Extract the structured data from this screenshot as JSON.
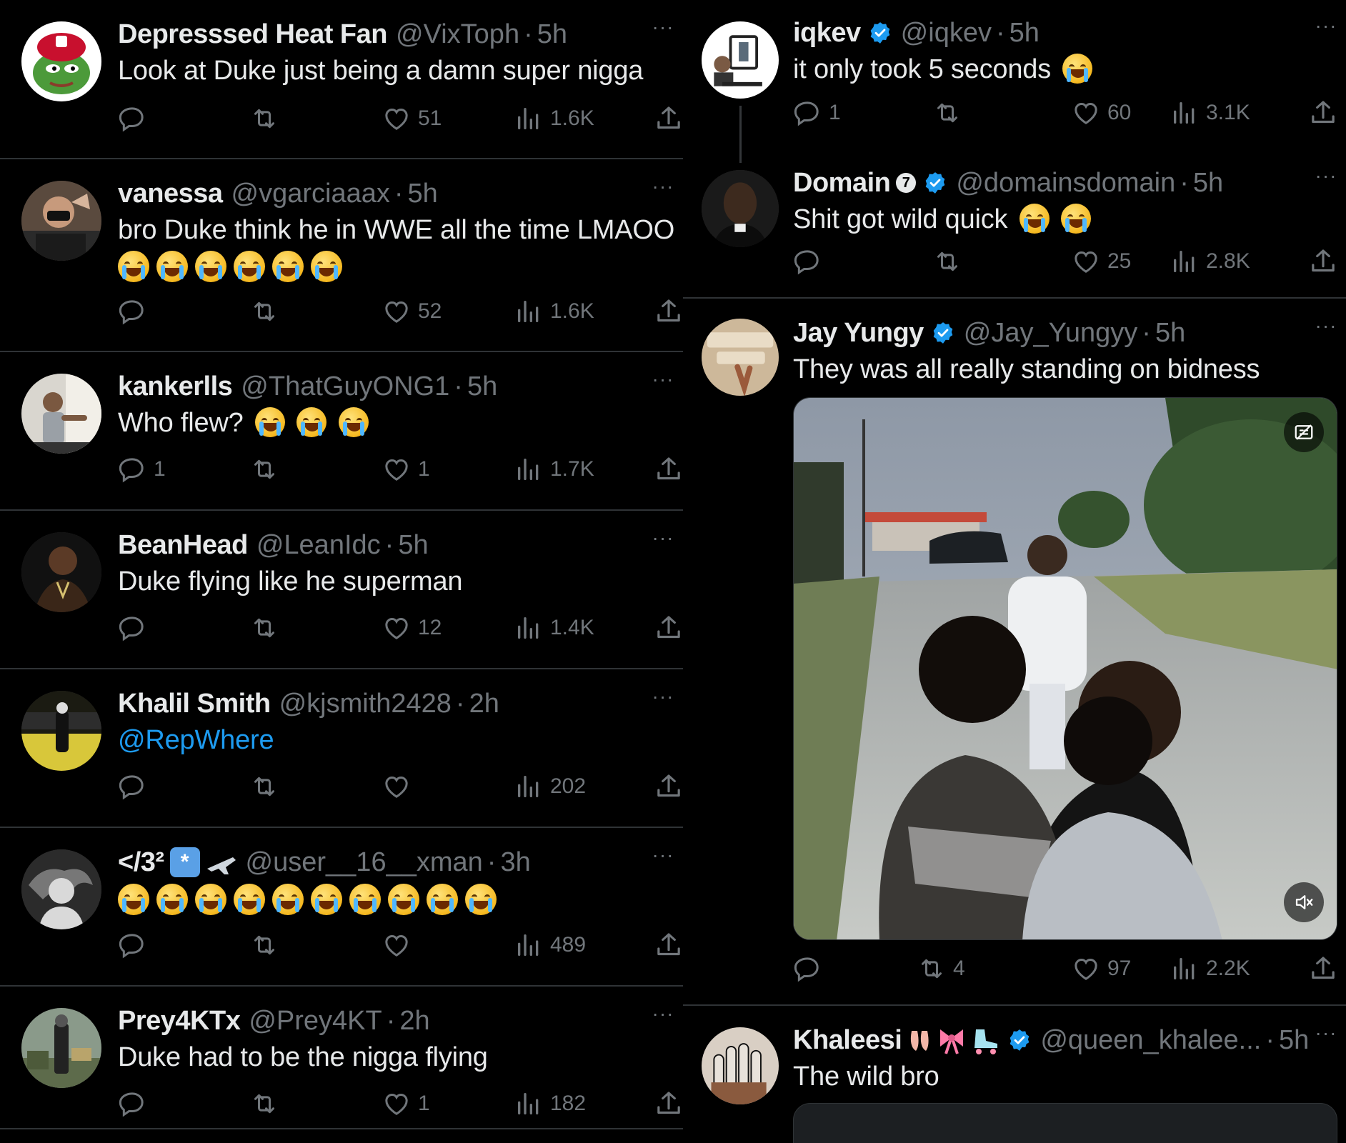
{
  "left": {
    "tweets": [
      {
        "name": "Depresssed Heat Fan",
        "handle": "@VixToph",
        "time": "5h",
        "text": "Look at Duke just being a damn super nigga",
        "reply_count": "",
        "like_count": "51",
        "view_count": "1.6K"
      },
      {
        "name": "vanessa",
        "handle": "@vgarciaaax",
        "time": "5h",
        "text": "bro Duke think he in WWE all the time LMAOO",
        "reply_count": "",
        "like_count": "52",
        "view_count": "1.6K"
      },
      {
        "name": "kankerlls",
        "handle": "@ThatGuyONG1",
        "time": "5h",
        "text": "Who flew?",
        "reply_count": "1",
        "like_count": "1",
        "view_count": "1.7K"
      },
      {
        "name": "BeanHead",
        "handle": "@LeanIdc",
        "time": "5h",
        "text": "Duke flying like he superman",
        "reply_count": "",
        "like_count": "12",
        "view_count": "1.4K"
      },
      {
        "name": "Khalil Smith",
        "handle": "@kjsmith2428",
        "time": "2h",
        "text": "@RepWhere",
        "reply_count": "",
        "like_count": "",
        "view_count": "202"
      },
      {
        "name": "</3²",
        "handle": "@user__16__xman",
        "time": "3h",
        "text": "",
        "reply_count": "",
        "like_count": "",
        "view_count": "489"
      },
      {
        "name": "Prey4KTx",
        "handle": "@Prey4KT",
        "time": "2h",
        "text": "Duke had to be the nigga flying",
        "reply_count": "",
        "like_count": "1",
        "view_count": "182"
      }
    ]
  },
  "right": {
    "tweets": [
      {
        "name": "iqkev",
        "handle": "@iqkev",
        "time": "5h",
        "text": "it only took 5 seconds",
        "reply_count": "1",
        "retweet_count": "",
        "like_count": "60",
        "view_count": "3.1K"
      },
      {
        "name": "Domain",
        "handle": "@domainsdomain",
        "time": "5h",
        "text": "Shit got wild quick",
        "reply_count": "",
        "retweet_count": "",
        "like_count": "25",
        "view_count": "2.8K"
      },
      {
        "name": "Jay Yungy",
        "handle": "@Jay_Yungyy",
        "time": "5h",
        "text": "They was all really standing on bidness",
        "reply_count": "",
        "retweet_count": "4",
        "like_count": "97",
        "view_count": "2.2K"
      },
      {
        "name": "Khaleesi",
        "handle": "@queen_khalee...",
        "time": "5h",
        "text": "The wild bro",
        "reply_count": "",
        "retweet_count": "",
        "like_count": "",
        "view_count": ""
      }
    ]
  },
  "colors": {
    "background": "#000000",
    "text": "#e7e9ea",
    "muted": "#71767b",
    "link": "#1d9bf0",
    "verified": "#1d9bf0",
    "divider": "#2f3336"
  }
}
